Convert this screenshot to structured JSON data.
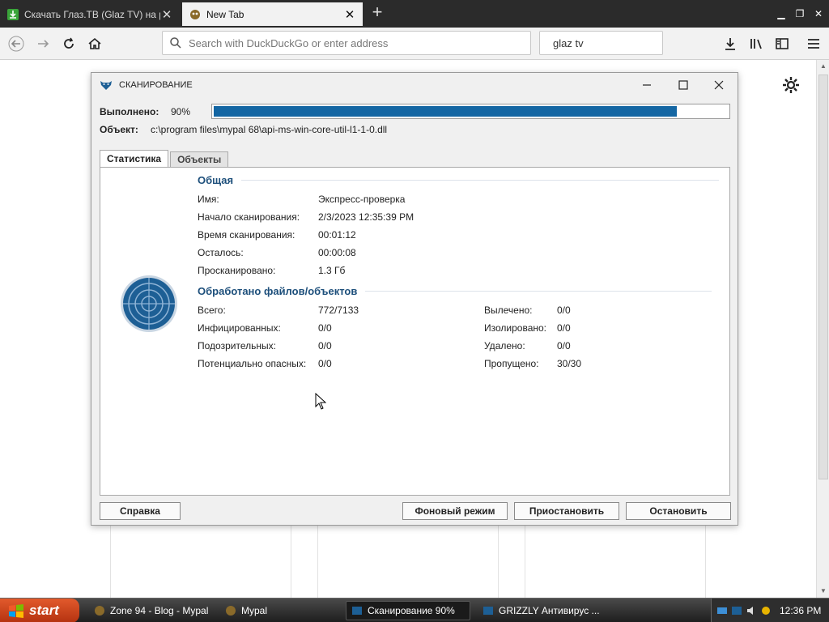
{
  "browser": {
    "tabs": [
      {
        "title": "Скачать Глаз.ТВ (Glaz TV) на ру",
        "active": false
      },
      {
        "title": "New Tab",
        "active": true
      }
    ],
    "url_placeholder": "Search with DuckDuckGo or enter address",
    "search_value": "glaz tv"
  },
  "dialog": {
    "title": "СКАНИРОВАНИЕ",
    "progress_label": "Выполнено:",
    "progress_text": "90%",
    "progress_value": 0.9,
    "object_label": "Объект:",
    "object_path": "c:\\program files\\mypal 68\\api-ms-win-core-util-l1-1-0.dll",
    "tabs": [
      "Статистика",
      "Объекты"
    ],
    "general": {
      "heading": "Общая",
      "rows": [
        {
          "label": "Имя:",
          "value": "Экспресс-проверка"
        },
        {
          "label": "Начало сканирования:",
          "value": "2/3/2023 12:35:39 PM"
        },
        {
          "label": "Время сканирования:",
          "value": "00:01:12"
        },
        {
          "label": "Осталось:",
          "value": "00:00:08"
        },
        {
          "label": "Просканировано:",
          "value": "1.3 Гб"
        }
      ]
    },
    "processed": {
      "heading": "Обработано файлов/объектов",
      "left": [
        {
          "label": "Всего:",
          "value": "772/7133"
        },
        {
          "label": "Инфицированных:",
          "value": "0/0"
        },
        {
          "label": "Подозрительных:",
          "value": "0/0"
        },
        {
          "label": "Потенциально опасных:",
          "value": "0/0"
        }
      ],
      "right": [
        {
          "label": "Вылечено:",
          "value": "0/0"
        },
        {
          "label": "Изолировано:",
          "value": "0/0"
        },
        {
          "label": "Удалено:",
          "value": "0/0"
        },
        {
          "label": "Пропущено:",
          "value": "30/30"
        }
      ]
    },
    "buttons": {
      "help": "Справка",
      "background": "Фоновый режим",
      "pause": "Приостановить",
      "stop": "Остановить"
    }
  },
  "taskbar": {
    "start": "start",
    "tasks": [
      {
        "label": "Zone 94 - Blog - Mypal",
        "active": false
      },
      {
        "label": "Mypal",
        "active": false
      },
      {
        "label": "Сканирование 90%",
        "active": true
      },
      {
        "label": "GRIZZLY Антивирус ...",
        "active": false
      }
    ],
    "clock": "12:36 PM"
  },
  "colors": {
    "accent": "#1466a3",
    "heading": "#1d4f7b",
    "tabstrip": "#2b2b2b"
  }
}
